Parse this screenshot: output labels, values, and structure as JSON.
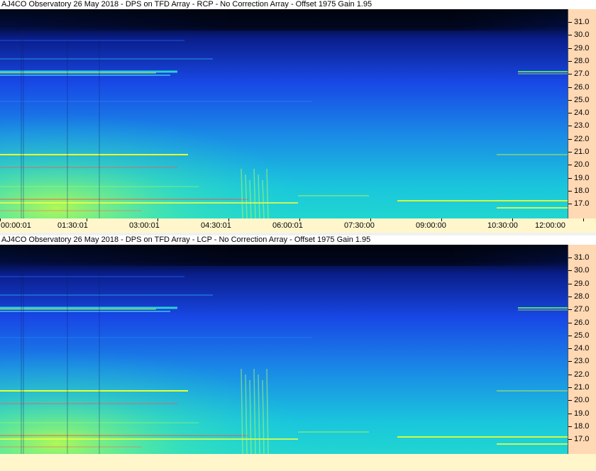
{
  "panels": [
    {
      "title": "AJ4CO Observatory 26 May 2018 - DPS on TFD Array  - RCP  -  No Correction Array  -  Offset 1975  Gain 1.95",
      "polarization": "RCP"
    },
    {
      "title": "AJ4CO Observatory 26 May 2018 - DPS on TFD Array  - LCP  -  No Correction Array  -  Offset 1975  Gain 1.95",
      "polarization": "LCP"
    }
  ],
  "freq_axis": {
    "labels": [
      "31.0",
      "30.0",
      "29.0",
      "28.0",
      "27.0",
      "26.0",
      "25.0",
      "24.0",
      "23.0",
      "22.0",
      "21.0",
      "20.0",
      "19.0",
      "18.0",
      "17.0"
    ]
  },
  "time_axis": {
    "labels": [
      "00:00:01",
      "01:30:01",
      "03:00:01",
      "04:30:01",
      "06:00:01",
      "07:30:00",
      "09:00:00",
      "10:30:00",
      "12:00:00"
    ]
  },
  "colors": {
    "axis_bg": "#ffd8b4",
    "timebar_bg": "#fff6cc",
    "spectrum_top": "#000a2a",
    "spectrum_mid": "#1446e6",
    "spectrum_bottom": "#1ed2d8"
  }
}
